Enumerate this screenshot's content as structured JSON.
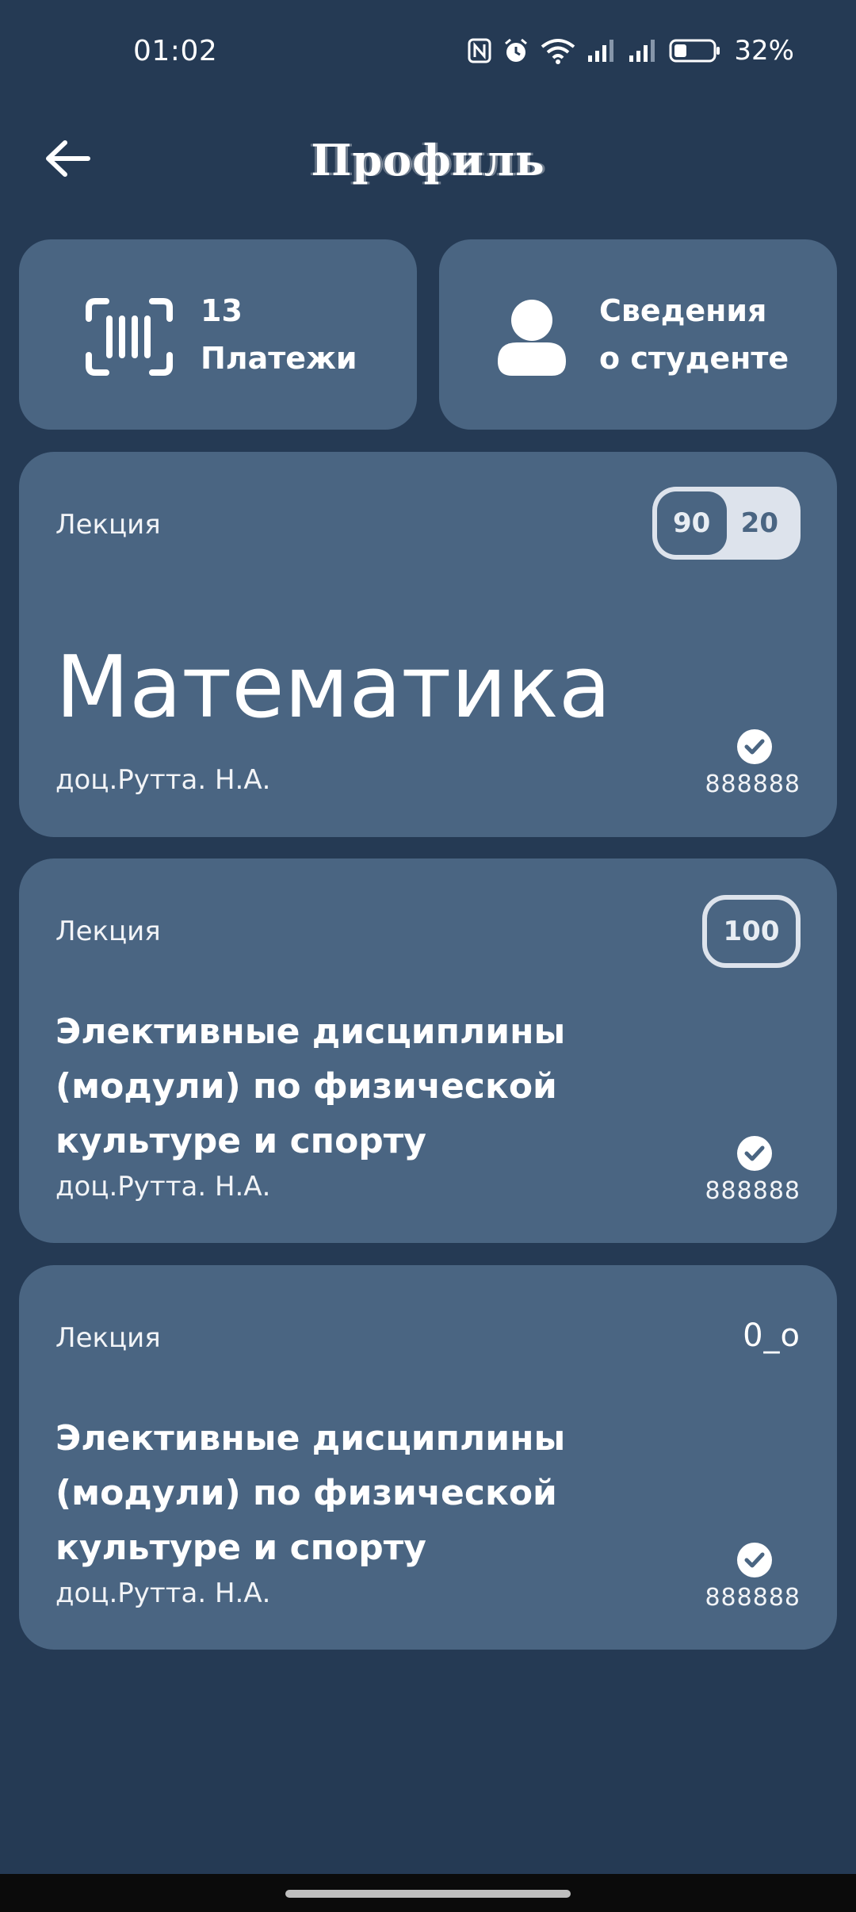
{
  "status_bar": {
    "time": "01:02",
    "battery": "32%",
    "icons": [
      "nfc-icon",
      "alarm-icon",
      "wifi-icon",
      "signal-icon",
      "signal-icon",
      "battery-icon"
    ]
  },
  "header": {
    "title": "Профиль",
    "back_icon": "arrow-left-icon"
  },
  "quick_cards": {
    "payments": {
      "count": "13",
      "label": "Платежи",
      "icon": "barcode-scan-icon"
    },
    "student_info": {
      "line1": "Сведения",
      "line2": "о студенте",
      "icon": "person-icon"
    }
  },
  "subjects": [
    {
      "type": "Лекция",
      "title": "Математика",
      "teacher": "доц.Рутта. Н.А.",
      "code": "888888",
      "scores": [
        "90",
        "20"
      ]
    },
    {
      "type": "Лекция",
      "title_lines": [
        "Элективные дисциплины",
        "(модули) по физической",
        "культуре и спорту"
      ],
      "teacher": "доц.Рутта. Н.А.",
      "code": "888888",
      "score": "100"
    },
    {
      "type": "Лекция",
      "title_lines": [
        "Элективные дисциплины",
        "(модули) по физической",
        "культуре и спорту"
      ],
      "teacher": "доц.Рутта. Н.А.",
      "code": "888888",
      "score": "0_o"
    }
  ],
  "colors": {
    "background": "#253a54",
    "card": "#4a6582",
    "pill": "#dde3ec"
  }
}
